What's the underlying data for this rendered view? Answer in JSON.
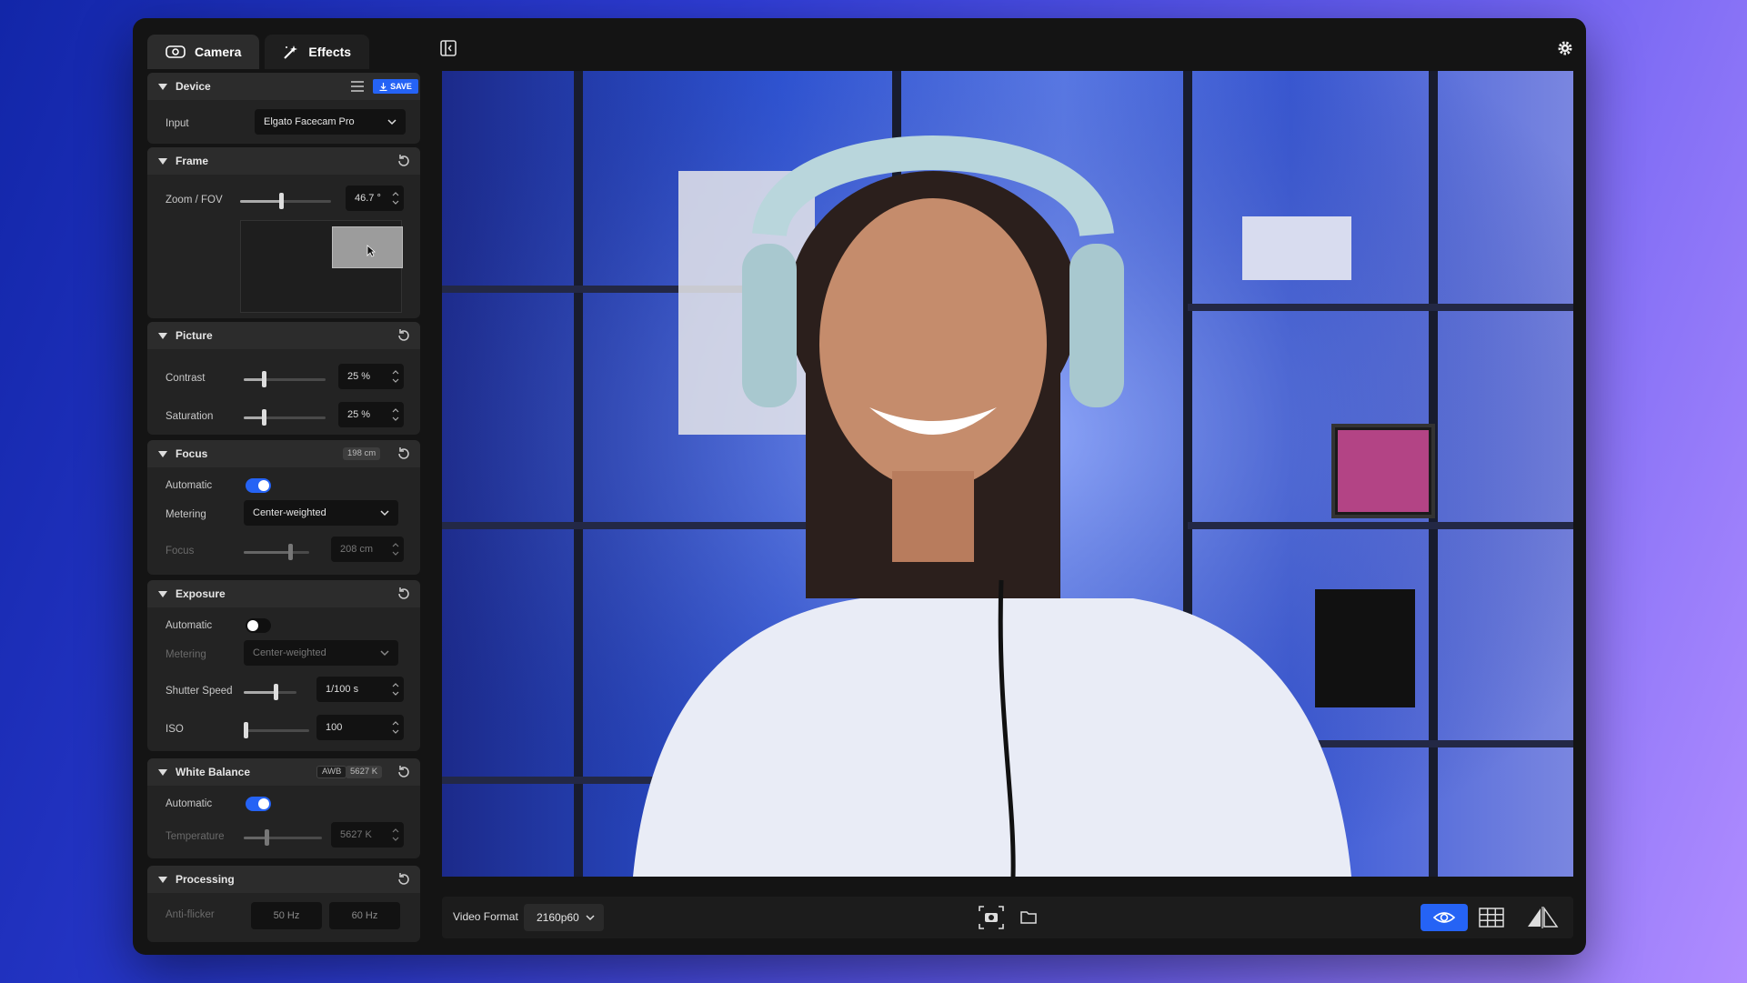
{
  "tabs": [
    {
      "label": "Camera"
    },
    {
      "label": "Effects"
    }
  ],
  "device": {
    "title": "Device",
    "save_label": "SAVE",
    "input_label": "Input",
    "input_value": "Elgato Facecam Pro"
  },
  "frame": {
    "title": "Frame",
    "zoom_label": "Zoom / FOV",
    "zoom_value": "46.7 °",
    "zoom_level": 0.45
  },
  "picture": {
    "title": "Picture",
    "contrast_label": "Contrast",
    "contrast_value": "25 %",
    "contrast_level": 0.25,
    "saturation_label": "Saturation",
    "saturation_value": "25 %",
    "saturation_level": 0.25
  },
  "focus": {
    "title": "Focus",
    "badge": "198 cm",
    "auto_label": "Automatic",
    "metering_label": "Metering",
    "metering_value": "Center-weighted",
    "focus_label": "Focus",
    "focus_value": "208 cm",
    "focus_level": 0.72
  },
  "exposure": {
    "title": "Exposure",
    "auto_label": "Automatic",
    "metering_label": "Metering",
    "metering_value": "Center-weighted",
    "shutter_label": "Shutter Speed",
    "shutter_value": "1/100 s",
    "shutter_level": 0.62,
    "iso_label": "ISO",
    "iso_value": "100",
    "iso_level": 0.03
  },
  "white_balance": {
    "title": "White Balance",
    "badge_awb": "AWB",
    "badge_temp": "5627 K",
    "auto_label": "Automatic",
    "temp_label": "Temperature",
    "temp_value": "5627 K",
    "temp_level": 0.3
  },
  "processing": {
    "title": "Processing",
    "antiflicker_label": "Anti-flicker",
    "hz50": "50 Hz",
    "hz60": "60 Hz"
  },
  "bottombar": {
    "video_format_label": "Video Format",
    "video_format_value": "2160p60"
  },
  "colors": {
    "accent": "#2563f5",
    "panel": "#232323",
    "header": "#2c2c2c"
  }
}
